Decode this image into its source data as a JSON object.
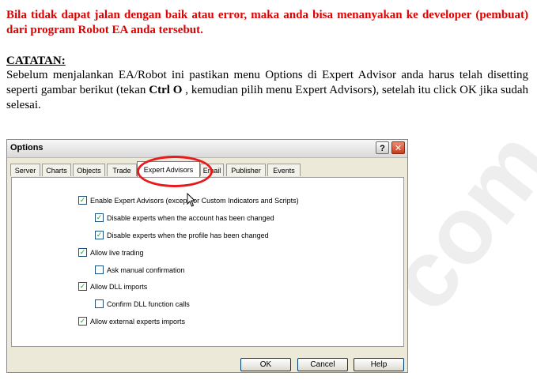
{
  "watermark": "com",
  "warning_text": "Bila tidak dapat jalan dengan baik atau error, maka anda bisa menanyakan ke developer (pembuat) dari program Robot EA anda tersebut.",
  "note": {
    "title": "CATATAN:",
    "body_before": "Sebelum menjalankan EA/Robot ini pastikan menu Options di Expert Advisor anda harus telah disetting seperti gambar berikut (tekan ",
    "shortcut": "Ctrl O",
    "body_after": " , kemudian pilih menu Expert Advisors), setelah itu click OK jika sudah selesai."
  },
  "dialog": {
    "title": "Options",
    "help_glyph": "?",
    "close_glyph": "✕",
    "tabs": [
      "Server",
      "Charts",
      "Objects",
      "Trade",
      "Expert Advisors",
      "Email",
      "Publisher",
      "Events"
    ],
    "active_tab": "Expert Advisors",
    "options": [
      {
        "label": "Enable Expert Advisors (except for Custom Indicators and Scripts)",
        "checked": true
      },
      {
        "label": "Disable experts when the account has been changed",
        "checked": true
      },
      {
        "label": "Disable experts when the profile has been changed",
        "checked": true
      },
      {
        "label": "Allow live trading",
        "checked": true
      },
      {
        "label": "Ask manual confirmation",
        "checked": false
      },
      {
        "label": "Allow DLL imports",
        "checked": true
      },
      {
        "label": "Confirm DLL function calls",
        "checked": false
      },
      {
        "label": "Allow external experts imports",
        "checked": true
      }
    ],
    "buttons": {
      "ok": "OK",
      "cancel": "Cancel",
      "help": "Help"
    }
  },
  "colors": {
    "warning": "#e00000",
    "highlight": "#e8191a",
    "check": "#21a121"
  }
}
